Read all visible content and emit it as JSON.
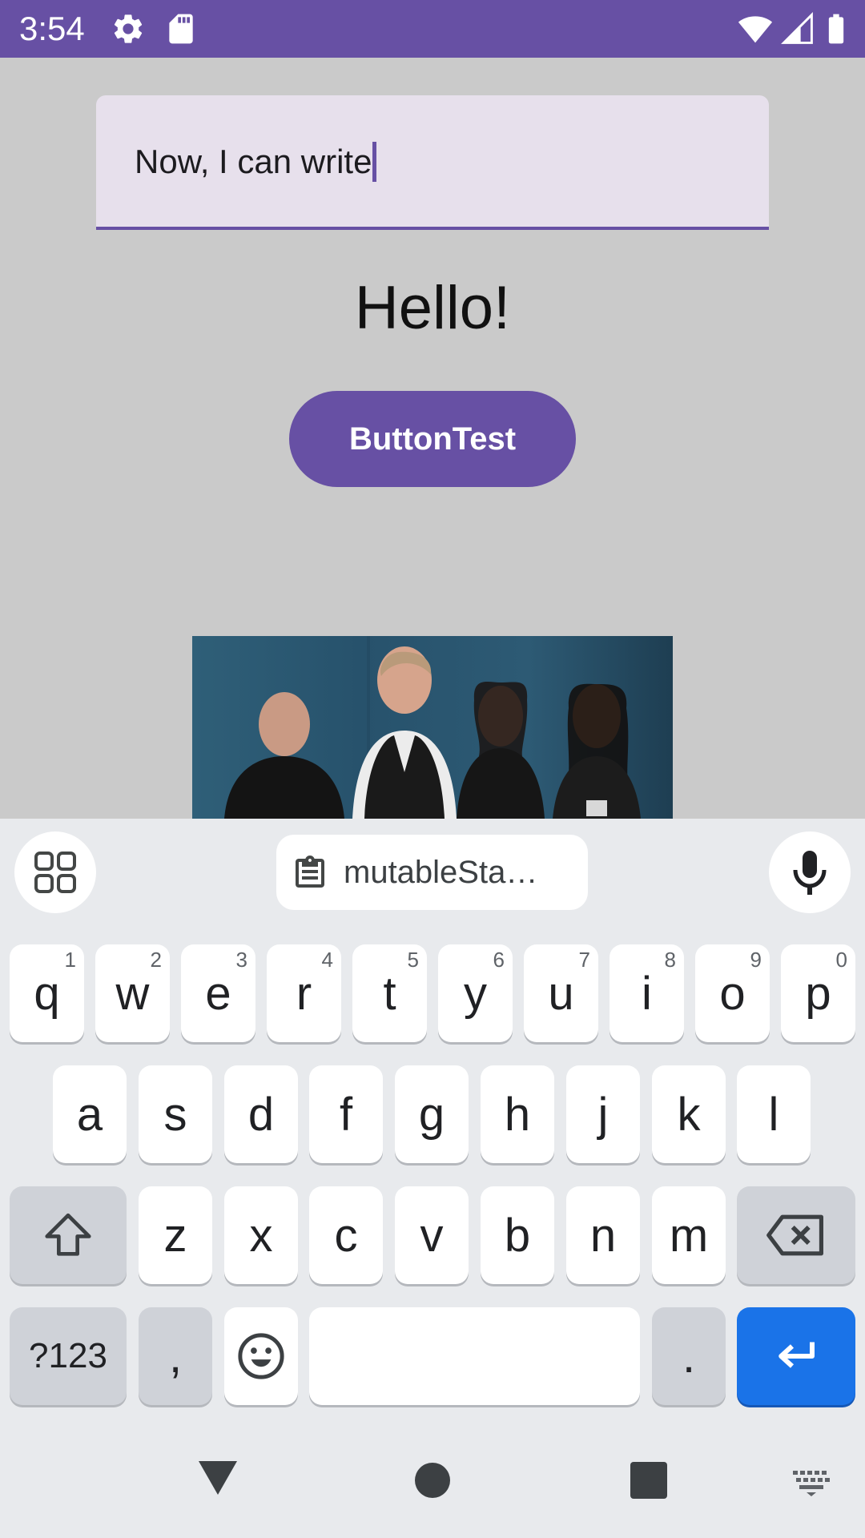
{
  "status_bar": {
    "time": "3:54",
    "left_icons": [
      "gear-icon",
      "sd-card-icon"
    ],
    "right_icons": [
      "wifi-icon",
      "signal-icon",
      "battery-icon"
    ],
    "color": "#6750a4"
  },
  "app": {
    "text_field": {
      "value": "Now, I can write"
    },
    "greeting": "Hello!",
    "button_label": "ButtonTest",
    "photo_icon": "band-photo",
    "accent_color": "#6750a4",
    "background_color": "#cacaca"
  },
  "keyboard": {
    "suggestion_chip": "mutableSta…",
    "toolbar_icons": [
      "apps-grid-icon",
      "clipboard-icon",
      "mic-icon"
    ],
    "row1": [
      {
        "label": "q",
        "hint": "1"
      },
      {
        "label": "w",
        "hint": "2"
      },
      {
        "label": "e",
        "hint": "3"
      },
      {
        "label": "r",
        "hint": "4"
      },
      {
        "label": "t",
        "hint": "5"
      },
      {
        "label": "y",
        "hint": "6"
      },
      {
        "label": "u",
        "hint": "7"
      },
      {
        "label": "i",
        "hint": "8"
      },
      {
        "label": "o",
        "hint": "9"
      },
      {
        "label": "p",
        "hint": "0"
      }
    ],
    "row2": [
      "a",
      "s",
      "d",
      "f",
      "g",
      "h",
      "j",
      "k",
      "l"
    ],
    "row3": [
      "z",
      "x",
      "c",
      "v",
      "b",
      "n",
      "m"
    ],
    "row4": {
      "symbols": "?123",
      "comma": ",",
      "period": "."
    },
    "special_icons": [
      "shift-icon",
      "backspace-icon",
      "emoji-icon",
      "enter-icon"
    ],
    "enter_color": "#1a73e8"
  },
  "nav_bar": {
    "icons": [
      "back-icon",
      "home-icon",
      "recents-icon",
      "keyboard-switch-icon"
    ]
  }
}
